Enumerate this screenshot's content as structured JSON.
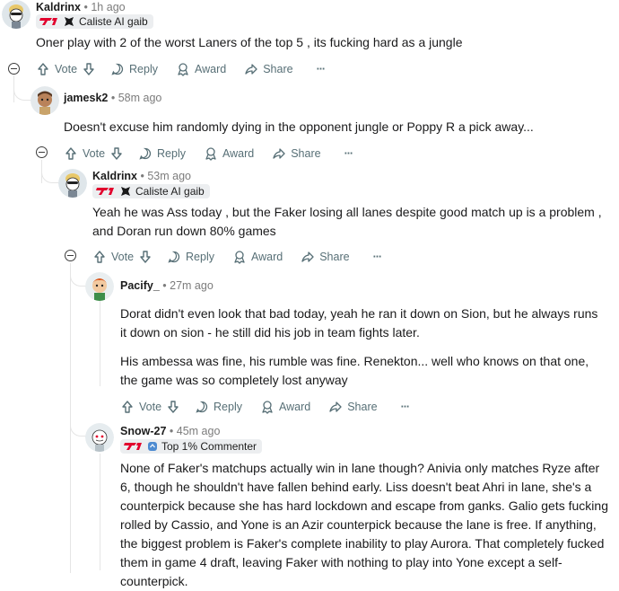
{
  "comments": [
    {
      "username": "Kaldrinx",
      "time": "1h ago",
      "flair": "Caliste AI gaib",
      "body": [
        "Oner play with 2 of the worst Laners of the top 5 , its fucking hard as a jungle"
      ],
      "actions": {
        "vote": "Vote",
        "reply": "Reply",
        "award": "Award",
        "share": "Share",
        "more": "···"
      }
    },
    {
      "username": "jamesk2",
      "time": "58m ago",
      "body": [
        "Doesn't excuse him randomly dying in the opponent jungle or Poppy R a pick away..."
      ],
      "actions": {
        "vote": "Vote",
        "reply": "Reply",
        "award": "Award",
        "share": "Share",
        "more": "···"
      }
    },
    {
      "username": "Kaldrinx",
      "time": "53m ago",
      "flair": "Caliste AI gaib",
      "body": [
        "Yeah he was Ass today , but the Faker losing all lanes despite good match up is a problem , and Doran run down 80% games"
      ],
      "actions": {
        "vote": "Vote",
        "reply": "Reply",
        "award": "Award",
        "share": "Share",
        "more": "···"
      }
    },
    {
      "username": "Pacify_",
      "time": "27m ago",
      "body": [
        "Dorat didn't even look that bad today, yeah he ran it down on Sion, but he always runs it down on sion - he still did his job in team fights later.",
        "His ambessa was fine, his rumble was fine. Renekton... well who knows on that one, the game was so completely lost anyway"
      ],
      "actions": {
        "vote": "Vote",
        "reply": "Reply",
        "award": "Award",
        "share": "Share",
        "more": "···"
      }
    },
    {
      "username": "Snow-27",
      "time": "45m ago",
      "flair": "Top 1% Commenter",
      "body": [
        "None of Faker's matchups actually win in lane though? Anivia only matches Ryze after 6, though he shouldn't have fallen behind early. Liss doesn't beat Ahri in lane, she's a counterpick because she has hard lockdown and escape from ganks. Galio gets fucking rolled by Cassio, and Yone is an Azir counterpick because the lane is free. If anything, the biggest problem is Faker's complete inability to play Aurora. That completely fucked them in game 4 draft, leaving Faker with nothing to play into Yone except a self-counterpick."
      ]
    }
  ],
  "colors": {
    "t1_red": "#e2012d",
    "accent_blue": "#4d8bd1"
  },
  "icons": [
    "upvote-icon",
    "downvote-icon",
    "reply-icon",
    "award-icon",
    "share-icon",
    "more-icon",
    "collapse-icon",
    "t1-logo-icon",
    "caliste-emblem-icon",
    "commenter-badge-icon"
  ]
}
